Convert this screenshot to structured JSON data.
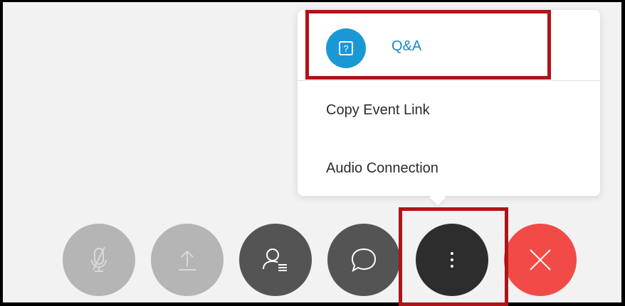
{
  "menu": {
    "qa_label": "Q&A",
    "copy_event_link_label": "Copy Event Link",
    "audio_connection_label": "Audio Connection"
  },
  "icons": {
    "qa": "question-icon",
    "mute": "microphone-muted-icon",
    "share": "upload-icon",
    "participants": "participants-icon",
    "chat": "chat-bubble-icon",
    "more": "more-vertical-icon",
    "end": "close-icon"
  },
  "colors": {
    "accent": "#1a98d5",
    "highlight": "#b01318",
    "end_call": "#f24b47"
  }
}
